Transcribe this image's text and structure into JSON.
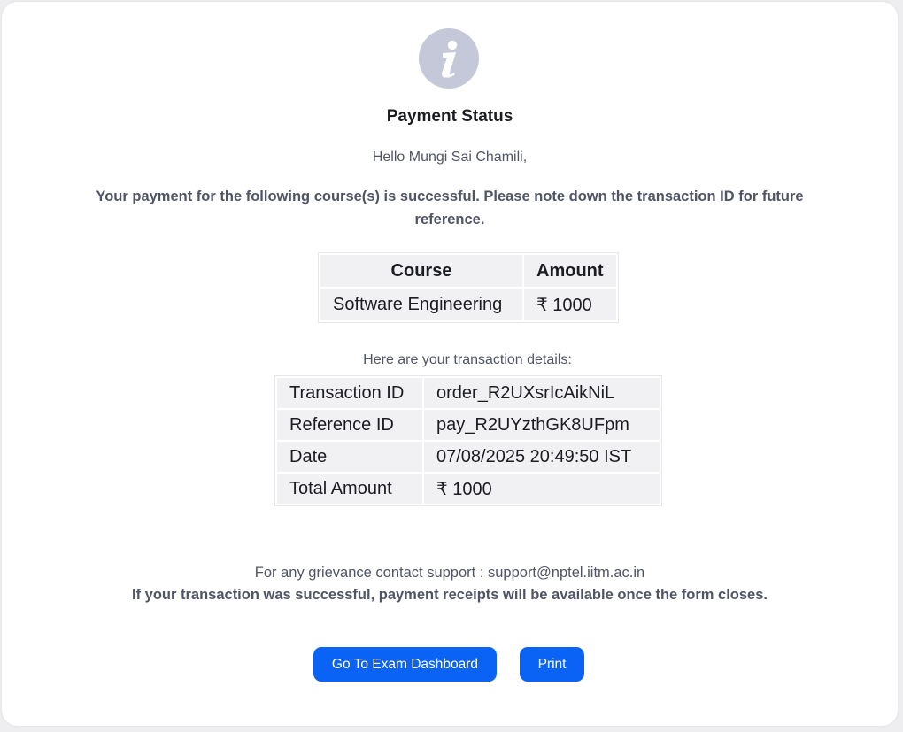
{
  "header": {
    "icon": "info-icon",
    "title": "Payment Status"
  },
  "greeting": "Hello Mungi Sai Chamili,",
  "message": "Your payment for the following course(s) is successful. Please note down the transaction ID for future reference.",
  "course_table": {
    "headers": [
      "Course",
      "Amount"
    ],
    "rows": [
      [
        "Software Engineering",
        "₹ 1000"
      ]
    ]
  },
  "details_label": "Here are your transaction details:",
  "transaction_table": {
    "rows": [
      [
        "Transaction ID",
        "order_R2UXsrIcAikNiL"
      ],
      [
        "Reference ID",
        "pay_R2UYzthGK8UFpm"
      ],
      [
        "Date",
        "07/08/2025 20:49:50 IST"
      ],
      [
        "Total Amount",
        "₹ 1000"
      ]
    ]
  },
  "support_text": "For any grievance contact support : support@nptel.iitm.ac.in",
  "receipt_note": "If your transaction was successful, payment receipts will be available once the form closes.",
  "buttons": {
    "dashboard": "Go To Exam Dashboard",
    "print": "Print"
  },
  "colors": {
    "accent": "#0b63f6",
    "icon_bg": "#c5c8d9",
    "text_muted": "#505466"
  }
}
